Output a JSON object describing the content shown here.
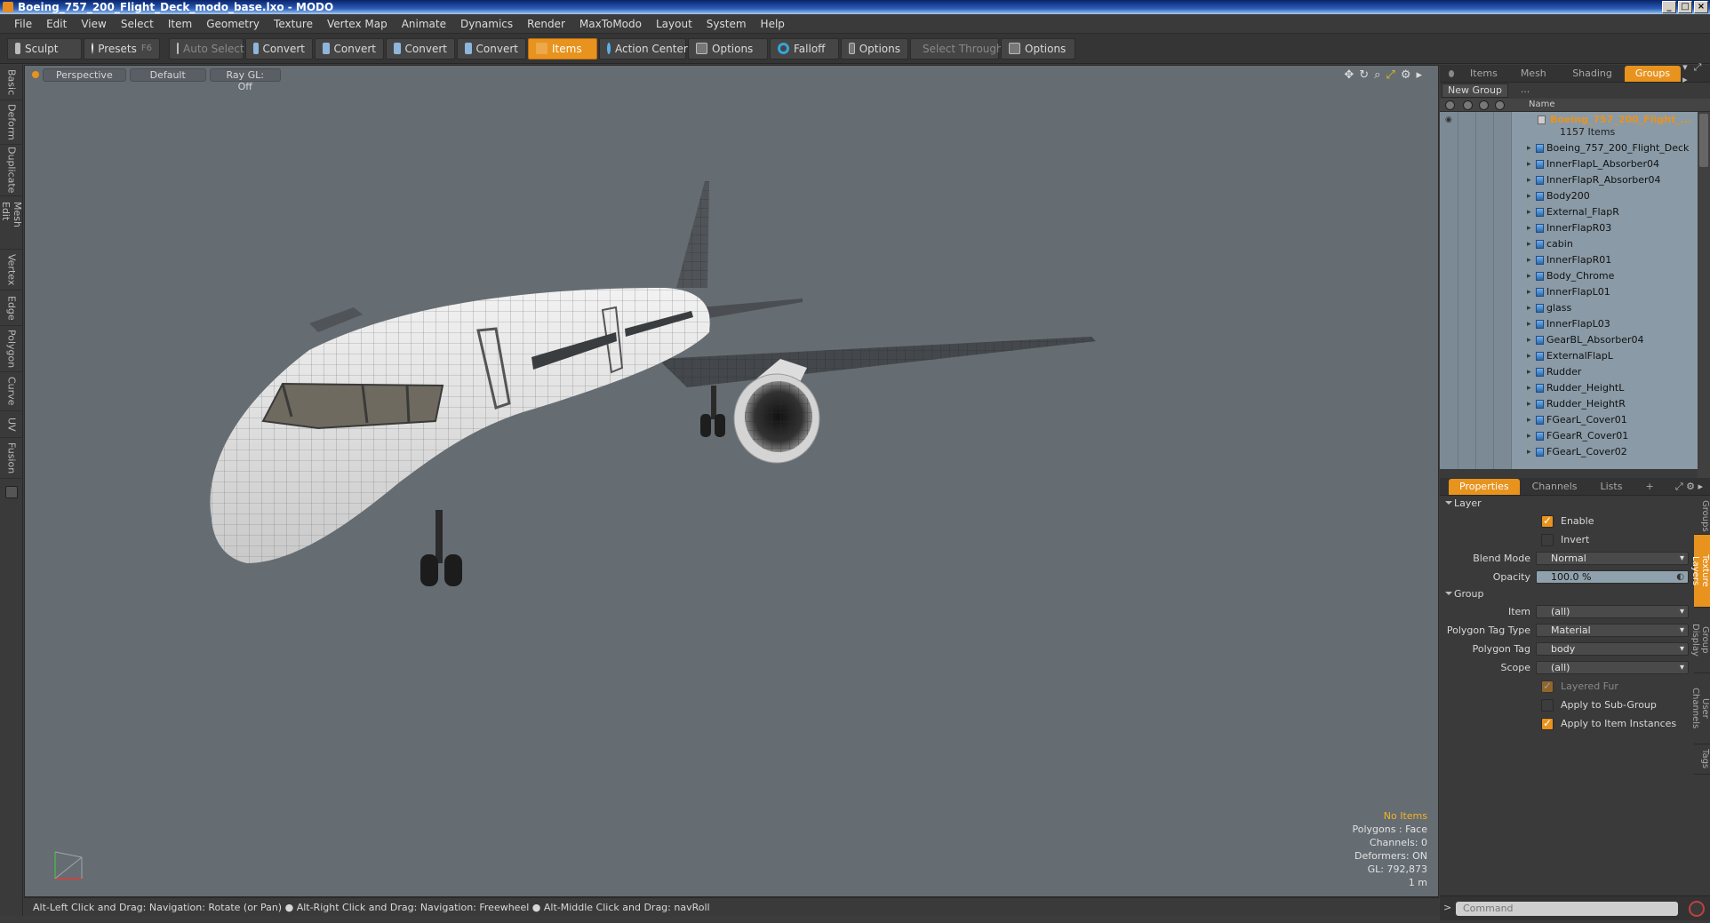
{
  "window": {
    "title": "Boeing_757_200_Flight_Deck_modo_base.lxo - MODO"
  },
  "menu": [
    "File",
    "Edit",
    "View",
    "Select",
    "Item",
    "Geometry",
    "Texture",
    "Vertex Map",
    "Animate",
    "Dynamics",
    "Render",
    "MaxToModo",
    "Layout",
    "System",
    "Help"
  ],
  "toolbar": {
    "sculpt": "Sculpt",
    "presets": "Presets",
    "presets_key": "F6",
    "auto_select": "Auto Select",
    "convert1": "Convert",
    "convert2": "Convert",
    "convert3": "Convert",
    "convert4": "Convert",
    "items": "Items",
    "action_center": "Action Center",
    "options1": "Options",
    "falloff": "Falloff",
    "options2": "Options",
    "select_through": "Select Through",
    "options3": "Options"
  },
  "left_tabs": [
    "Basic",
    "Deform",
    "Duplicate",
    "Mesh Edit",
    "Vertex",
    "Edge",
    "Polygon",
    "Curve",
    "UV",
    "Fusion"
  ],
  "viewport": {
    "view": "Perspective",
    "shading": "Default",
    "raygl": "Ray GL: Off",
    "info": {
      "items": "No Items",
      "polygons": "Polygons : Face",
      "channels": "Channels: 0",
      "deformers": "Deformers: ON",
      "gl": "GL: 792,873",
      "scale": "1 m"
    }
  },
  "statusbar": "Alt-Left Click and Drag: Navigation: Rotate (or Pan) ● Alt-Right Click and Drag: Navigation: Freewheel ● Alt-Middle Click and Drag: navRoll",
  "top_panel": {
    "tabs": [
      "Items",
      "Mesh ...",
      "Shading",
      "Groups"
    ],
    "new_group": "New Group",
    "header_name": "Name",
    "group_name": "Boeing_757_200_Flight_...",
    "group_count": "1157 Items",
    "items": [
      "Boeing_757_200_Flight_Deck",
      "InnerFlapL_Absorber04",
      "InnerFlapR_Absorber04",
      "Body200",
      "External_FlapR",
      "InnerFlapR03",
      "cabin",
      "InnerFlapR01",
      "Body_Chrome",
      "InnerFlapL01",
      "glass",
      "InnerFlapL03",
      "GearBL_Absorber04",
      "ExternalFlapL",
      "Rudder",
      "Rudder_HeightL",
      "Rudder_HeightR",
      "FGearL_Cover01",
      "FGearR_Cover01",
      "FGearL_Cover02"
    ]
  },
  "properties": {
    "tabs": [
      "Properties",
      "Channels",
      "Lists"
    ],
    "add_tab": "+",
    "layer_section": "Layer",
    "enable": "Enable",
    "invert": "Invert",
    "blend_mode_label": "Blend Mode",
    "blend_mode": "Normal",
    "opacity_label": "Opacity",
    "opacity": "100.0 %",
    "group_section": "Group",
    "item_label": "Item",
    "item": "(all)",
    "ptt_label": "Polygon Tag Type",
    "ptt": "Material",
    "pt_label": "Polygon Tag",
    "pt": "body",
    "scope_label": "Scope",
    "scope": "(all)",
    "layered_fur": "Layered Fur",
    "apply_sub": "Apply to Sub-Group",
    "apply_inst": "Apply to Item Instances"
  },
  "right_vtabs": [
    "Groups",
    "Texture Layers",
    "Group Display",
    "User Channels",
    "Tags"
  ],
  "command": {
    "placeholder": "Command"
  }
}
